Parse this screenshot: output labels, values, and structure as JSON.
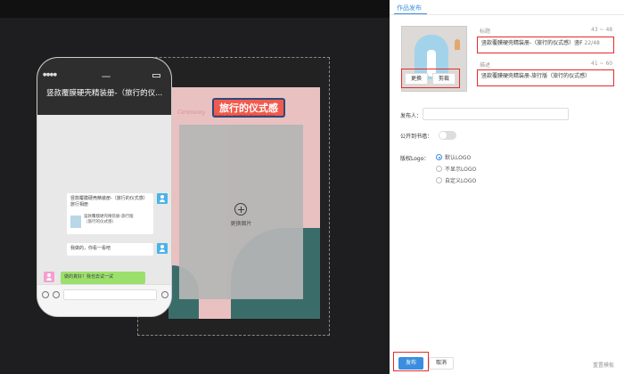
{
  "phone": {
    "title": "竖款覆膜硬壳精装册-（旅行的仪...",
    "msg1_text": "竖款覆膜硬壳精装册-（旅行的仪式感）旅行相册",
    "msg1_card_desc": "竖款覆膜硬壳精装册-旅行版（旅行的仪式感）",
    "msg2_text": "我做的，你看一看吧",
    "msg3_text": "做的真好！我也去试一试"
  },
  "canvas": {
    "cover_title": "旅行的仪式感",
    "cover_subtitle": "A sign of a wonderful life to start a trip",
    "cover_script": "Ceremony",
    "replace_image_label": "更换图片"
  },
  "panel": {
    "tab_label": "作品发布",
    "thumb_replace_label": "更换",
    "thumb_crop_label": "剪裁",
    "title_label": "标题",
    "title_count": "43 ~ 48",
    "title_value": "竖款覆膜硬壳精装册-（旅行的仪式感）竖F",
    "title_char_count": "22/48",
    "desc_label": "描述",
    "desc_count": "41 ~ 60",
    "desc_value": "竖款覆膜硬壳精装册-旅行版（旅行的仪式感）",
    "publisher_label": "发布人：",
    "bookshelf_label": "公开到书墙：",
    "logo_label": "版权Logo：",
    "logo_options": [
      "默认LOGO",
      "不显示LOGO",
      "自定义LOGO"
    ],
    "publish_label": "发布",
    "cancel_label": "取消",
    "reset_label": "重置模板"
  },
  "colors": {
    "accent": "#3b8de0",
    "highlight": "#e52b2b",
    "chat_green": "#9ce06c"
  }
}
